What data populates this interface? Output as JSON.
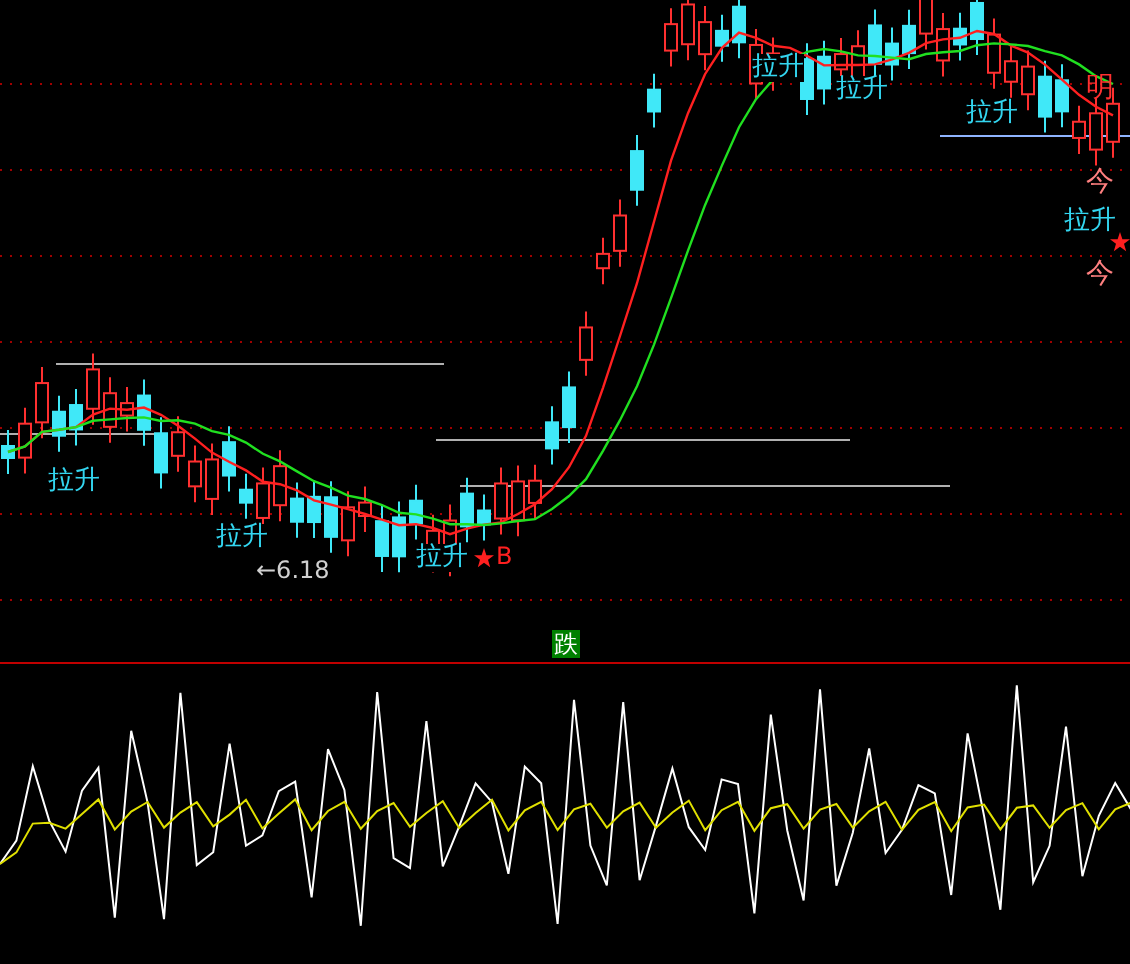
{
  "price_panel": {
    "signals": [
      {
        "text": "拉升"
      },
      {
        "text": "拉升"
      },
      {
        "text": "拉升"
      },
      {
        "text": "拉升"
      },
      {
        "text": "拉升"
      },
      {
        "text": "拉升"
      },
      {
        "text": "拉升"
      }
    ],
    "low_marker": "←6.18",
    "buy_marker": "B",
    "right_labels": [
      "明",
      "今",
      "今"
    ]
  },
  "divider_badge": "跌"
}
